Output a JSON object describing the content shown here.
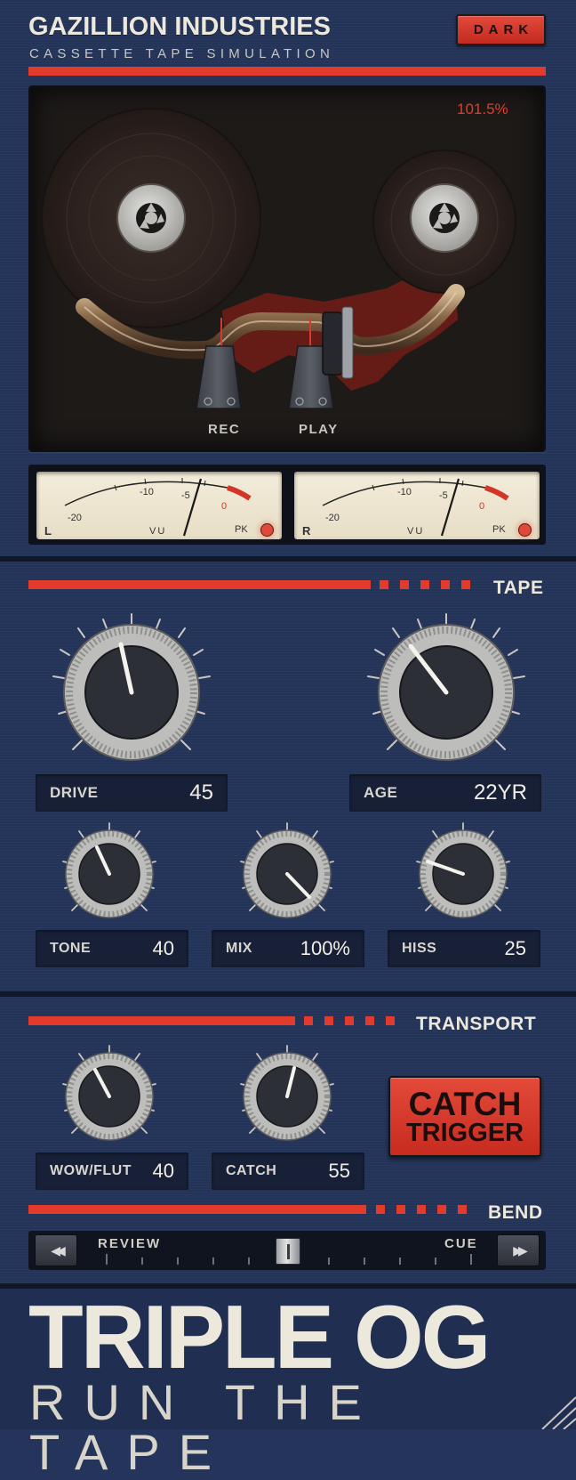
{
  "header": {
    "brand": "GAZILLION INDUSTRIES",
    "subtitle": "CASSETTE TAPE SIMULATION",
    "theme_button": "DARK"
  },
  "tape_window": {
    "speed": "101.5%",
    "rec_label": "REC",
    "play_label": "PLAY"
  },
  "vu_meters": [
    {
      "channel": "L",
      "scale": [
        "-20",
        "-10",
        "-5",
        "0"
      ],
      "vu_label": "VU",
      "pk_label": "PK"
    },
    {
      "channel": "R",
      "scale": [
        "-20",
        "-10",
        "-5",
        "0"
      ],
      "vu_label": "VU",
      "pk_label": "PK"
    }
  ],
  "tape_section": {
    "title": "TAPE",
    "controls": [
      {
        "label": "DRIVE",
        "value": "45"
      },
      {
        "label": "AGE",
        "value": "22YR"
      },
      {
        "label": "TONE",
        "value": "40"
      },
      {
        "label": "MIX",
        "value": "100%"
      },
      {
        "label": "HISS",
        "value": "25"
      }
    ]
  },
  "transport_section": {
    "title": "TRANSPORT",
    "controls": [
      {
        "label": "WOW/FLUT",
        "value": "40"
      },
      {
        "label": "CATCH",
        "value": "55"
      }
    ],
    "catch_button": {
      "line1": "CATCH",
      "line2": "TRIGGER"
    }
  },
  "bend_section": {
    "title": "BEND",
    "review_label": "REVIEW",
    "cue_label": "CUE",
    "rewind_icon": "◀◀",
    "forward_icon": "▶▶",
    "slider_position": 0.5
  },
  "footer": {
    "title": "TRIPLE OG",
    "tagline": "RUN THE TAPE"
  },
  "colors": {
    "accent_red": "#e23a2b",
    "panel_blue": "#25355b",
    "cream": "#ece8dc"
  }
}
